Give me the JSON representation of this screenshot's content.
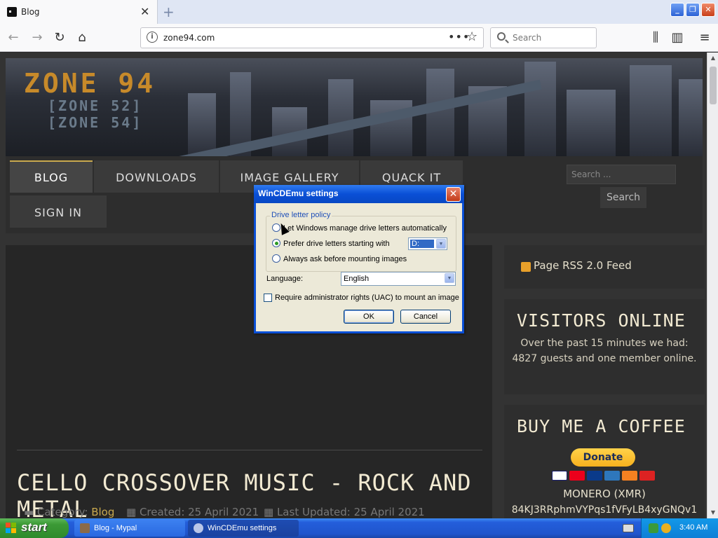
{
  "browser": {
    "tab_title": "Blog",
    "tab_close": "✕",
    "new_tab": "+",
    "url": "zone94.com",
    "search_placeholder": "Search",
    "more_icon": "•••",
    "star_icon": "☆"
  },
  "site": {
    "logo_main": "ZONE 94",
    "logo_sub1": "[ZONE 52]",
    "logo_sub2": "[ZONE 54]",
    "menu": [
      {
        "label": "BLOG",
        "active": true
      },
      {
        "label": "DOWNLOADS",
        "active": false
      },
      {
        "label": "IMAGE GALLERY",
        "active": false
      },
      {
        "label": "QUACK IT",
        "active": false
      },
      {
        "label": "SIGN IN",
        "active": false
      }
    ],
    "search_placeholder": "Search ...",
    "search_button": "Search",
    "article_title": "CELLO CROSSOVER MUSIC - ROCK AND METAL",
    "meta": {
      "category_label": "Category:",
      "category": "Blog",
      "created": "Created: 25 April 2021",
      "updated": "Last Updated: 25 April 2021"
    },
    "rss": "Page RSS 2.0 Feed",
    "visitors": {
      "title": "VISITORS ONLINE",
      "text": "Over the past 15 minutes we had: 4827 guests and one member online."
    },
    "coffee": {
      "title": "BUY ME A COFFEE",
      "donate": "Donate",
      "monero_title": "MONERO (XMR)",
      "monero_addr": "84KJ3RRphmVYPqs1fVFyLB4xyGNQv1"
    }
  },
  "dialog": {
    "title": "WinCDEmu settings",
    "group_label": "Drive letter policy",
    "options": [
      {
        "label": "Let Windows manage drive letters automatically",
        "selected": false
      },
      {
        "label": "Prefer drive letters starting with",
        "selected": true
      },
      {
        "label": "Always ask before mounting images",
        "selected": false
      }
    ],
    "drive_value": "D:",
    "language_label": "Language:",
    "language_value": "English",
    "uac_label": "Require administrator rights (UAC) to mount an image",
    "ok": "OK",
    "cancel": "Cancel"
  },
  "taskbar": {
    "start": "start",
    "tasks": [
      {
        "label": "Blog - Mypal",
        "active": false
      },
      {
        "label": "WinCDEmu settings",
        "active": true
      }
    ],
    "clock": "3:40 AM"
  },
  "colors": {
    "accent_gold": "#c9a94e",
    "xp_blue": "#0a4fd6",
    "title_cream": "#f2ead2"
  }
}
